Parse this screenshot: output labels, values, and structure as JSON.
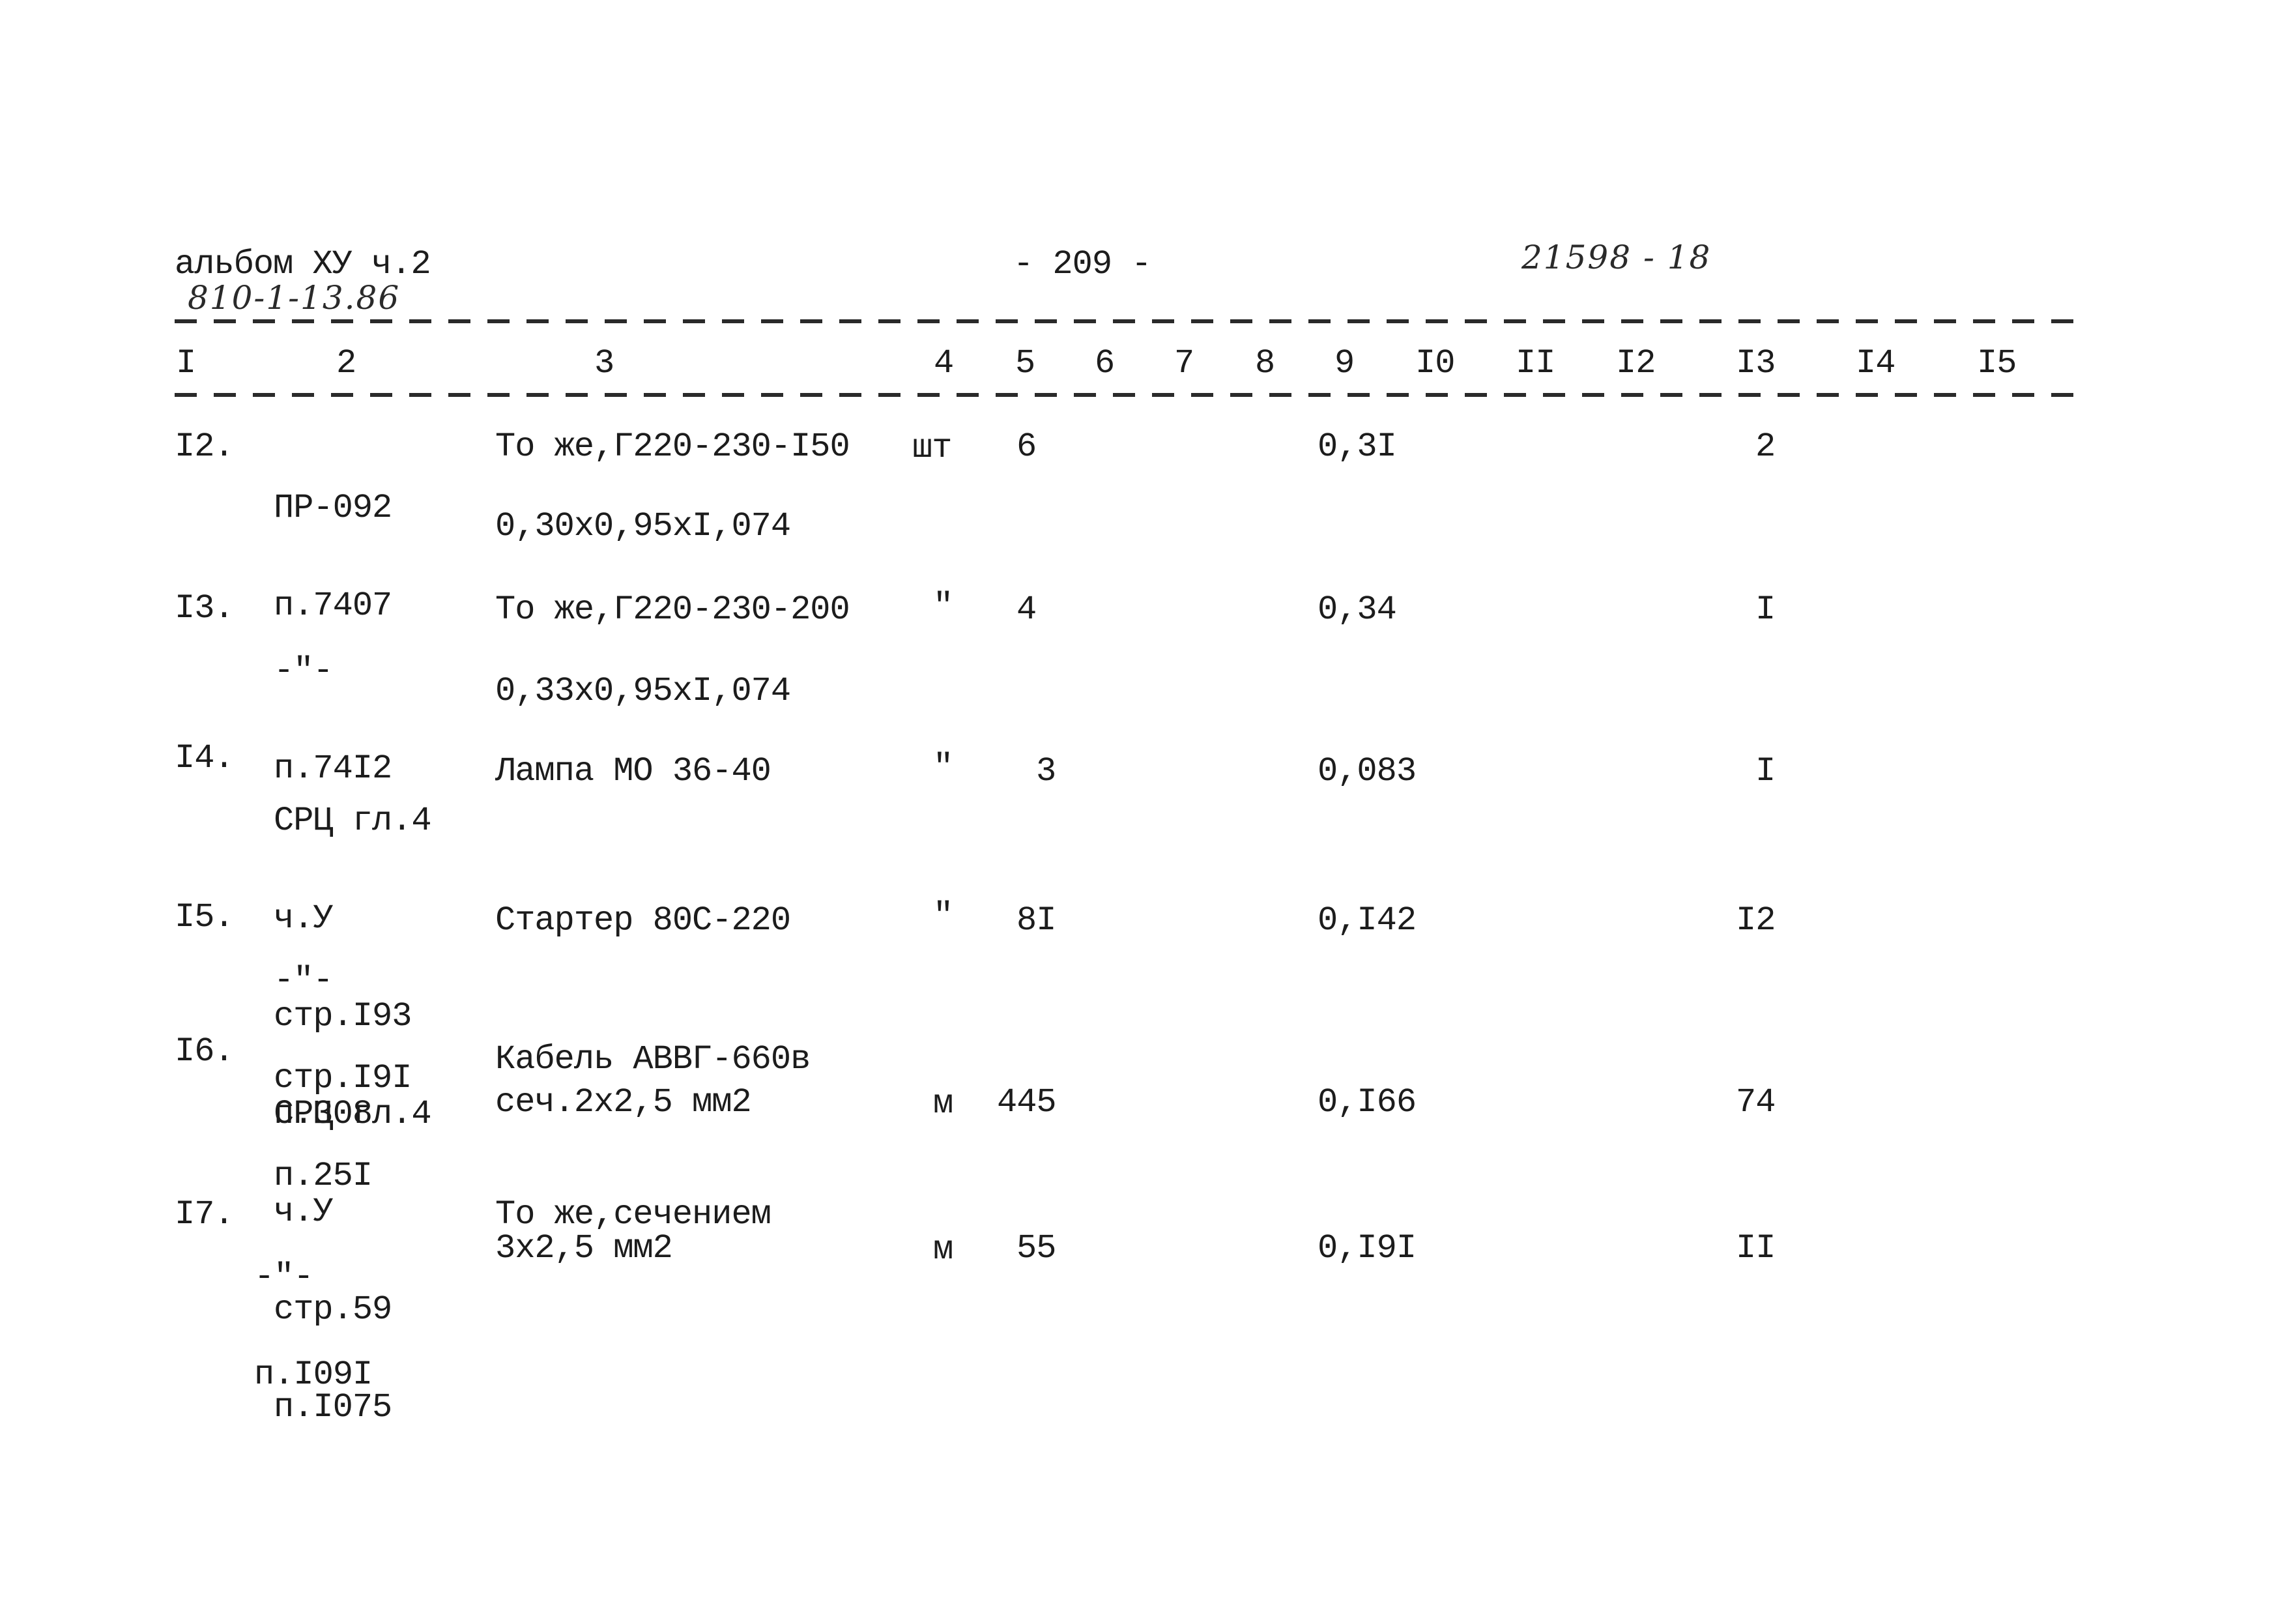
{
  "header": {
    "album": "альбом ХУ ч.2",
    "album_code": "810-1-13.86",
    "page_number": "- 209 -",
    "doc_number": "21598 - 18"
  },
  "columns": [
    "I",
    "2",
    "3",
    "4",
    "5",
    "6",
    "7",
    "8",
    "9",
    "I0",
    "II",
    "I2",
    "I3",
    "I4",
    "I5"
  ],
  "rows": [
    {
      "num": "I2.",
      "ref": [
        "ПР-092",
        "п.7407"
      ],
      "desc": [
        "То же,Г220-230-I50"
      ],
      "desc_extra": "0,30х0,95хI,074",
      "unit": "шт",
      "qty": "6",
      "col9": "0,3I",
      "col13": "2"
    },
    {
      "num": "I3.",
      "ref": [
        "-\"-",
        "п.74I2"
      ],
      "desc": [
        "То же,Г220-230-200"
      ],
      "desc_extra": "0,33х0,95хI,074",
      "unit": "\"",
      "qty": "4",
      "col9": "0,34",
      "col13": "I"
    },
    {
      "num": "I4.",
      "ref": [
        "СРЦ гл.4",
        "ч.У",
        "стр.I93",
        "п.308"
      ],
      "desc": [
        "Лампа МО 36-40"
      ],
      "desc_extra": "",
      "unit": "\"",
      "qty": "3",
      "col9": "0,083",
      "col13": "I"
    },
    {
      "num": "I5.",
      "ref": [
        "-\"-",
        "стр.I9I",
        "п.25I"
      ],
      "desc": [
        "Стартер 80С-220"
      ],
      "desc_extra": "",
      "unit": "\"",
      "qty": "8I",
      "col9": "0,I42",
      "col13": "I2"
    },
    {
      "num": "I6.",
      "ref": [
        "СРЦ гл.4",
        "ч.У",
        "стр.59",
        "п.I075"
      ],
      "desc": [
        "Кабель АВВГ-660в",
        "сеч.2х2,5 мм2"
      ],
      "desc_extra": "",
      "unit": "м",
      "qty": "445",
      "col9": "0,I66",
      "col13": "74"
    },
    {
      "num": "I7.",
      "ref": [
        "-\"-",
        "п.I09I"
      ],
      "desc": [
        "То же,сечением",
        "3х2,5 мм2"
      ],
      "desc_extra": "",
      "unit": "м",
      "qty": "55",
      "col9": "0,I9I",
      "col13": "II"
    }
  ]
}
